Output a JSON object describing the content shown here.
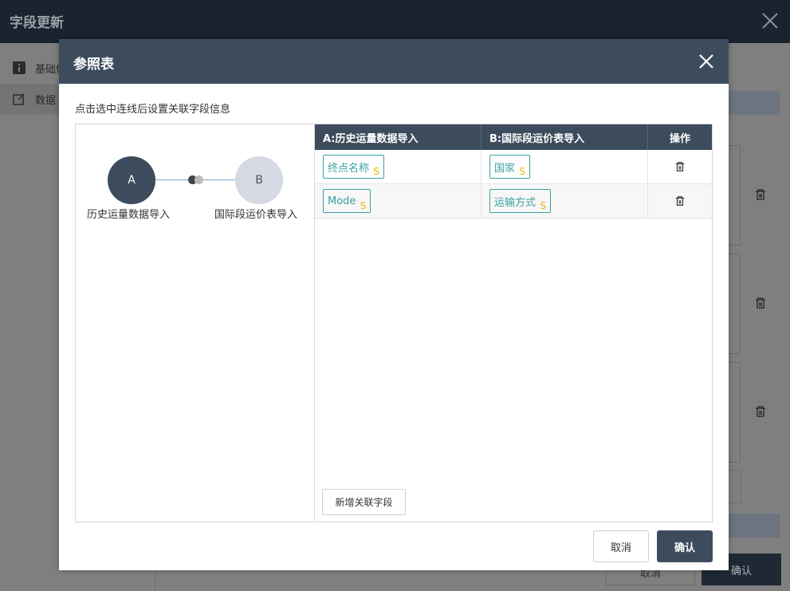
{
  "outer": {
    "title": "字段更新",
    "sidebar": [
      {
        "label": "基础信",
        "icon": "info-icon"
      },
      {
        "label": "数据",
        "icon": "edit-icon"
      }
    ],
    "cancel_label": "取消",
    "confirm_label": "确认"
  },
  "modal": {
    "title": "参照表",
    "hint": "点击选中连线后设置关联字段信息",
    "node_a": {
      "letter": "A",
      "label": "历史运量数据导入"
    },
    "node_b": {
      "letter": "B",
      "label": "国际段运价表导入"
    },
    "table": {
      "headers": [
        "A:历史运量数据导入",
        "B:国际段运价表导入",
        "操作"
      ],
      "rows": [
        {
          "a": "终点名称",
          "a_type": "S",
          "b": "国家",
          "b_type": "S"
        },
        {
          "a": "Mode",
          "a_type": "S",
          "b": "运输方式",
          "b_type": "S"
        }
      ]
    },
    "add_label": "新增关联字段",
    "cancel_label": "取消",
    "confirm_label": "确认"
  },
  "colors": {
    "header": "#3d4c5d",
    "chip_border": "#3aa1a1",
    "chip_type": "#f0b400",
    "node_b": "#d5d9e3"
  }
}
